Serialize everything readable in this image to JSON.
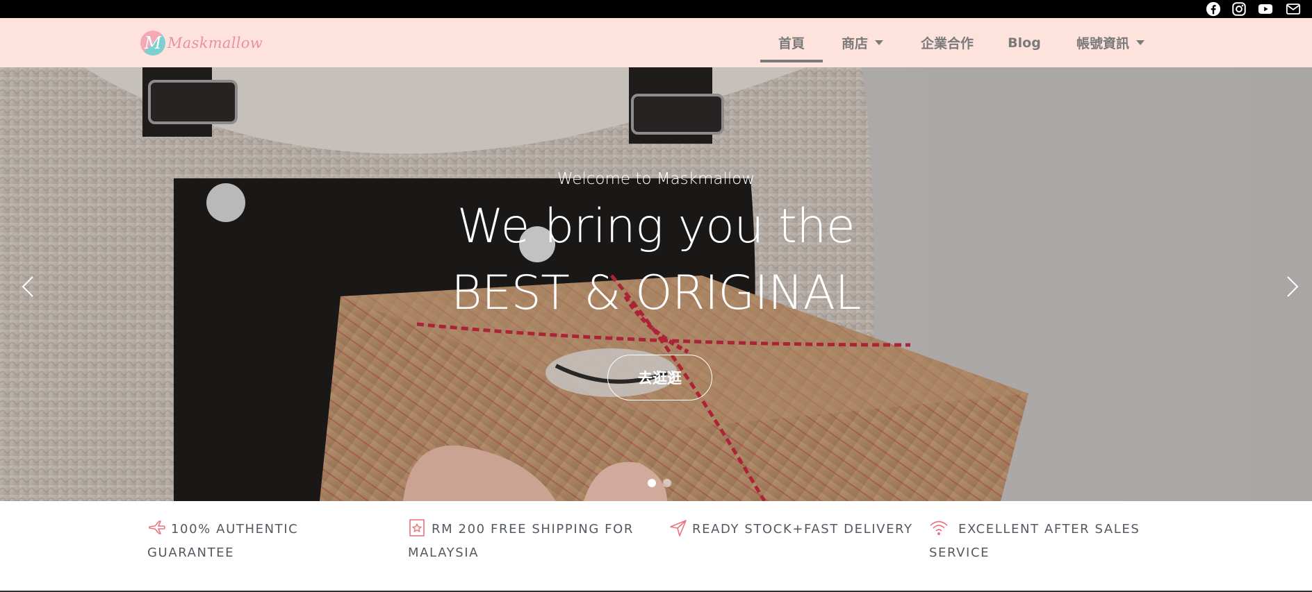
{
  "social": {
    "items": [
      {
        "name": "facebook-icon"
      },
      {
        "name": "instagram-icon"
      },
      {
        "name": "youtube-icon"
      },
      {
        "name": "email-icon"
      }
    ]
  },
  "header": {
    "logo_text": "Maskmallow",
    "logo_letter": "M",
    "nav": [
      {
        "label": "首頁",
        "active": true,
        "dropdown": false
      },
      {
        "label": "商店",
        "active": false,
        "dropdown": true
      },
      {
        "label": "企業合作",
        "active": false,
        "dropdown": false
      },
      {
        "label": "Blog",
        "active": false,
        "dropdown": false
      },
      {
        "label": "帳號資訊",
        "active": false,
        "dropdown": true
      }
    ]
  },
  "hero": {
    "kicker": "Welcome to Maskmallow",
    "line1": "We bring you the",
    "line2": "BEST & ORIGINAL",
    "button_label": "去逛逛",
    "slides": 2,
    "active_slide": 1
  },
  "features": [
    {
      "icon": "airplane-icon",
      "text": "100% AUTHENTIC GUARANTEE"
    },
    {
      "icon": "star-tag-icon",
      "text": "RM 200 FREE SHIPPING FOR MALAYSIA"
    },
    {
      "icon": "paper-plane-icon",
      "text": "READY STOCK+FAST DELIVERY"
    },
    {
      "icon": "wifi-icon",
      "text": "EXCELLENT AFTER SALES SERVICE"
    }
  ],
  "colors": {
    "header_bg": "#fee3dd",
    "accent_pink": "#ec8fa2",
    "logo_teal": "#7ecfd0",
    "nav_text": "#7a7a7a",
    "feature_text": "#54595f",
    "icon_red": "#e8747c"
  }
}
